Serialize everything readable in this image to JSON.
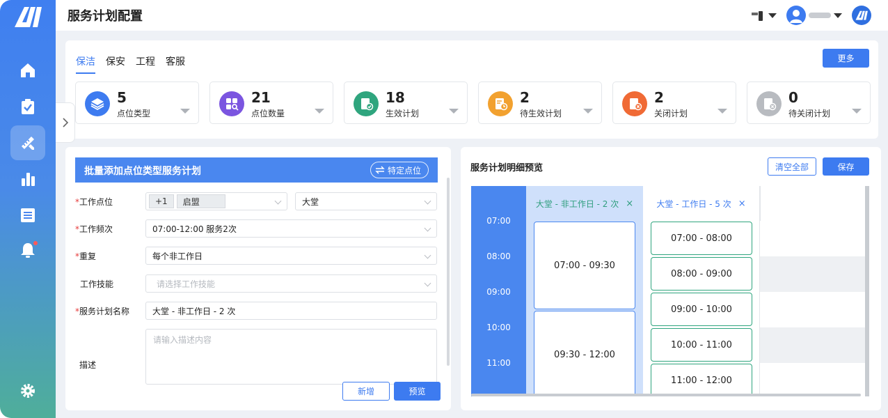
{
  "app": {
    "title": "服务计划配置",
    "header": {
      "avatar_icon": "user-avatar-icon",
      "app_logo_icon": "ai-logo-icon"
    }
  },
  "sidebar": {
    "items": [
      {
        "name": "home",
        "icon": "home-icon",
        "active": false
      },
      {
        "name": "tasks",
        "icon": "clipboard-check-icon",
        "active": false
      },
      {
        "name": "plan",
        "icon": "ruler-pencil-icon",
        "active": true
      },
      {
        "name": "stats",
        "icon": "bar-chart-icon",
        "active": false
      },
      {
        "name": "list",
        "icon": "list-icon",
        "active": false
      },
      {
        "name": "notifications",
        "icon": "bell-icon",
        "active": false
      },
      {
        "name": "settings",
        "icon": "gear-icon",
        "active": false
      }
    ]
  },
  "categories": {
    "tabs": [
      {
        "label": "保洁",
        "active": true
      },
      {
        "label": "保安",
        "active": false
      },
      {
        "label": "工程",
        "active": false
      },
      {
        "label": "客服",
        "active": false
      }
    ],
    "more_label": "更多"
  },
  "stats": [
    {
      "value": "5",
      "label": "点位类型",
      "color": "#3d7bf0",
      "icon": "layers-icon"
    },
    {
      "value": "21",
      "label": "点位数量",
      "color": "#7b55e0",
      "icon": "grid-search-icon"
    },
    {
      "value": "18",
      "label": "生效计划",
      "color": "#2fa57e",
      "icon": "doc-check-icon"
    },
    {
      "value": "2",
      "label": "待生效计划",
      "color": "#f2a12f",
      "icon": "doc-clock-icon"
    },
    {
      "value": "2",
      "label": "关闭计划",
      "color": "#f06a35",
      "icon": "doc-close-icon"
    },
    {
      "value": "0",
      "label": "待关闭计划",
      "color": "#b8bbc0",
      "icon": "doc-close-icon"
    }
  ],
  "form": {
    "title": "批量添加点位类型服务计划",
    "specific_label": "特定点位",
    "location": {
      "label": "工作点位",
      "tag_more": "+1",
      "tag": "启盟",
      "area": "大堂"
    },
    "frequency": {
      "label": "工作频次",
      "value": "07:00-12:00 服务2次"
    },
    "repeat": {
      "label": "重复",
      "value": "每个非工作日"
    },
    "skill": {
      "label": "工作技能",
      "placeholder": "请选择工作技能"
    },
    "plan_name": {
      "label": "服务计划名称",
      "value": "大堂 - 非工作日 - 2 次"
    },
    "description": {
      "label": "描述",
      "placeholder": "请输入描述内容"
    },
    "add_label": "新增",
    "preview_label": "预览"
  },
  "preview": {
    "title": "服务计划明细预览",
    "clear_label": "清空全部",
    "save_label": "保存",
    "times": [
      "07:00",
      "08:00",
      "09:00",
      "10:00",
      "11:00"
    ],
    "columns": [
      {
        "title": "大堂 - 非工作日 - 2 次",
        "close": "×",
        "slots": [
          "07:00 - 09:30",
          "09:30 - 12:00"
        ]
      },
      {
        "title": "大堂 - 工作日 - 5 次",
        "close": "×",
        "slots": [
          "07:00 - 08:00",
          "08:00 - 09:00",
          "09:00 - 10:00",
          "10:00 - 11:00",
          "11:00 - 12:00"
        ]
      }
    ]
  }
}
